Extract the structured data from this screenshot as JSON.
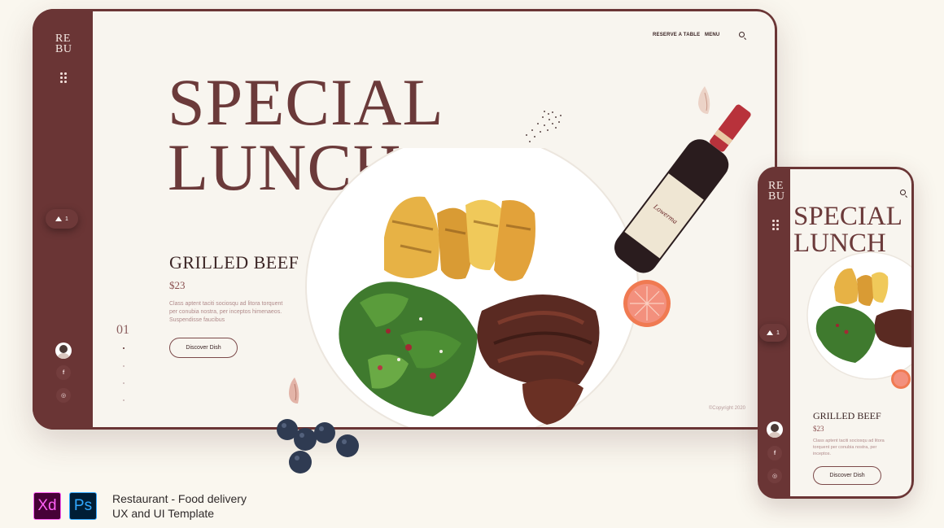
{
  "desktop": {
    "logo": [
      "RE",
      "BU"
    ],
    "nav": {
      "reserve": "RESERVE A TABLE",
      "menu": "MENU"
    },
    "hero": [
      "SPECIAL",
      "LUNCH"
    ],
    "dish": {
      "title": "GRILLED BEEF",
      "price": "$23",
      "description": "Class aptent taciti sociosqu ad litora torquent per conubia nostra, per inceptos himenaeos. Suspendisse faucibus",
      "button": "Discover Dish"
    },
    "slide_number": "01",
    "cart_count": "1",
    "social": {
      "facebook": "f",
      "instagram": "◎"
    },
    "copyright": "©Copyright 2020"
  },
  "mobile": {
    "logo": [
      "RE",
      "BU"
    ],
    "hero": [
      "SPECIAL",
      "LUNCH"
    ],
    "dish": {
      "title": "GRILLED BEEF",
      "price": "$23",
      "description": "Class aptent taciti sociosqu ad litora torquent per conubia nostra, per inceptos.",
      "button": "Discover Dish"
    },
    "cart_count": "1",
    "social": {
      "facebook": "f",
      "instagram": "◎"
    }
  },
  "branding": {
    "xd": "Xd",
    "ps": "Ps",
    "caption": [
      "Restaurant - Food delivery",
      "UX and UI Template"
    ]
  },
  "colors": {
    "brand": "#6a3535",
    "screen": "#f8f5ef",
    "background": "#faf7ef"
  }
}
